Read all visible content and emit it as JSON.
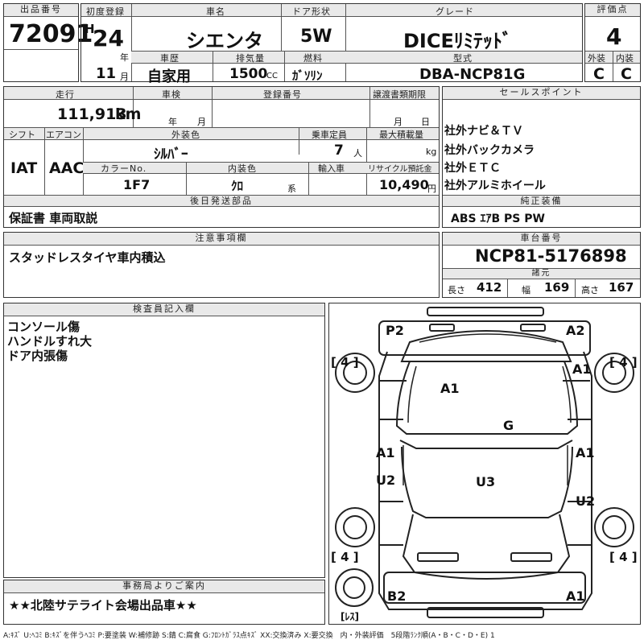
{
  "header": {
    "lot_label": "出品番号",
    "lot_no": "72091",
    "reg_label": "初度登録",
    "era": "H",
    "year": "24",
    "year_unit": "年",
    "month": "11",
    "month_unit": "月",
    "car_label": "車名",
    "car_name": "シエンタ",
    "door_label": "ドア形状",
    "door": "5W",
    "grade_label": "グレード",
    "grade": "DICEﾘﾐﾃｯﾄﾞ",
    "score_label": "評価点",
    "score": "4",
    "history_label": "車歴",
    "history": "自家用",
    "cc_label": "排気量",
    "cc": "1500",
    "cc_unit": "CC",
    "fuel_label": "燃料",
    "fuel": "ｶﾞｿﾘﾝ",
    "model_label": "型式",
    "model": "DBA-NCP81G",
    "ext_label": "外装",
    "ext": "C",
    "int_label": "内装",
    "int": "C"
  },
  "row2": {
    "mileage_label": "走行",
    "mileage": "111,913",
    "mileage_unit": "km",
    "inspect_label": "車検",
    "inspect_year": "年",
    "inspect_month": "月",
    "regno_label": "登録番号",
    "transfer_label": "譲渡書類期限",
    "transfer_month": "月",
    "transfer_day": "日",
    "shift_label": "シフト",
    "shift": "IAT",
    "ac_label": "エアコン",
    "ac": "AAC",
    "color_label": "外装色",
    "color": "ｼﾙﾊﾞｰ",
    "seats_label": "乗車定員",
    "seats": "7",
    "seats_unit": "人",
    "load_label": "最大積載量",
    "load_unit": "kg",
    "colorno_label": "カラーNo.",
    "colorno": "1F7",
    "intcolor_label": "内装色",
    "intcolor": "ｸﾛ",
    "intcolor_unit": "系",
    "import_label": "輸入車",
    "recycle_label": "リサイクル預託金",
    "recycle": "10,490",
    "recycle_unit": "円",
    "parts_label": "後日発送部品",
    "parts": "保証書 車両取説"
  },
  "sales": {
    "label": "セールスポイント",
    "items": [
      "社外ナビ＆ＴＶ",
      "社外バックカメラ",
      "社外ＥＴＣ",
      "社外アルミホイール"
    ],
    "equip_label": "純正装備",
    "equip": "ABS ｴｱB PS PW"
  },
  "notes": {
    "label": "注意事項欄",
    "text": "スタッドレスタイヤ車内積込"
  },
  "chassis": {
    "label": "車台番号",
    "number": "NCP81-5176898",
    "dims_label": "諸元",
    "len_label": "長さ",
    "len": "412",
    "wid_label": "幅",
    "wid": "169",
    "hgt_label": "高さ",
    "hgt": "167"
  },
  "inspector": {
    "label": "検査員記入欄",
    "lines": [
      "コンソール傷",
      "ハンドルすれ大",
      "ドア内張傷"
    ]
  },
  "office": {
    "label": "事務局よりご案内",
    "text": "★★北陸サテライト会場出品車★★"
  },
  "diagram": {
    "p2": "P2",
    "a2": "A2",
    "b2": "B2",
    "a1_rear": "A1",
    "a1_roof": "A1",
    "g": "G",
    "u3": "U3",
    "a1_left": "A1",
    "u2_left": "U2",
    "a1_right": "A1",
    "u2_right": "U2",
    "a1_rf": "A1",
    "tire_fl": "[ 4 ]",
    "tire_fr": "[ 4 ]",
    "tire_rl": "[ 4 ]",
    "tire_rr": "[ 4 ]",
    "spare": "[ﾚｽ]"
  },
  "legend": "A:ｷｽﾞ U:ﾍｺﾐ B:ｷｽﾞを伴うﾍｺﾐ P:要塗装 W:補修跡 S:錆 C:腐食 G:ﾌﾛﾝﾄｶﾞﾗｽ点ｷｽﾞ XX:交換済み X:要交換　内・外装評価　5段階ﾗﾝｸ順(A・B・C・D・E) 1"
}
